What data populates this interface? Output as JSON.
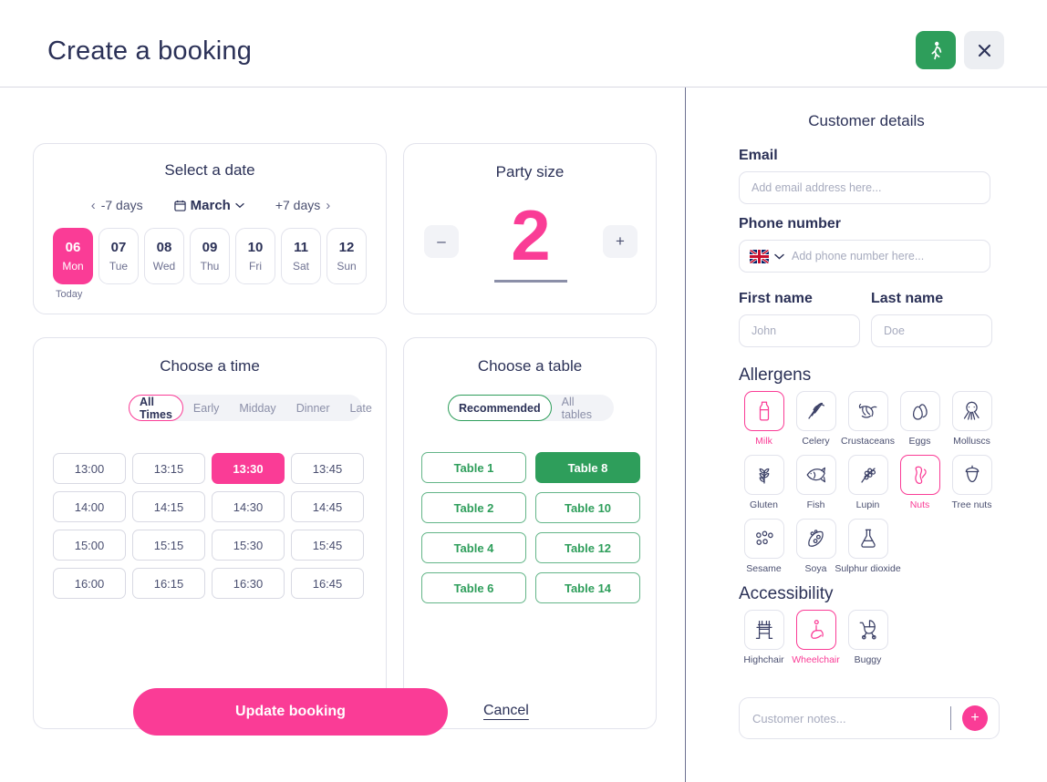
{
  "header": {
    "title": "Create a booking",
    "walkin_icon": "walking-person-icon",
    "walkin_color": "#2E9E5B",
    "close_icon": "close-icon"
  },
  "accent": {
    "pink": "#FA3C96",
    "green": "#2E9E5B",
    "navy": "#2B3157"
  },
  "date_section": {
    "title": "Select a date",
    "prev_label": "-7 days",
    "next_label": "+7 days",
    "month": "March",
    "calendar_icon": "calendar-icon",
    "chevron_left_icon": "chevron-left-icon",
    "chevron_right_icon": "chevron-right-icon",
    "chevron_down_icon": "chevron-down-icon",
    "today_label": "Today",
    "days": [
      {
        "num": "06",
        "dow": "Mon",
        "selected": true
      },
      {
        "num": "07",
        "dow": "Tue",
        "selected": false
      },
      {
        "num": "08",
        "dow": "Wed",
        "selected": false
      },
      {
        "num": "09",
        "dow": "Thu",
        "selected": false
      },
      {
        "num": "10",
        "dow": "Fri",
        "selected": false
      },
      {
        "num": "11",
        "dow": "Sat",
        "selected": false
      },
      {
        "num": "12",
        "dow": "Sun",
        "selected": false
      }
    ]
  },
  "party_section": {
    "title": "Party size",
    "value": "2",
    "decrement_label": "–",
    "increment_label": "+"
  },
  "time_section": {
    "title": "Choose a time",
    "filters": [
      {
        "label": "All Times",
        "active": true
      },
      {
        "label": "Early",
        "active": false
      },
      {
        "label": "Midday",
        "active": false
      },
      {
        "label": "Dinner",
        "active": false
      },
      {
        "label": "Late",
        "active": false
      }
    ],
    "slots": [
      {
        "label": "13:00",
        "selected": false
      },
      {
        "label": "13:15",
        "selected": false
      },
      {
        "label": "13:30",
        "selected": true
      },
      {
        "label": "13:45",
        "selected": false
      },
      {
        "label": "14:00",
        "selected": false
      },
      {
        "label": "14:15",
        "selected": false
      },
      {
        "label": "14:30",
        "selected": false
      },
      {
        "label": "14:45",
        "selected": false
      },
      {
        "label": "15:00",
        "selected": false
      },
      {
        "label": "15:15",
        "selected": false
      },
      {
        "label": "15:30",
        "selected": false
      },
      {
        "label": "15:45",
        "selected": false
      },
      {
        "label": "16:00",
        "selected": false
      },
      {
        "label": "16:15",
        "selected": false
      },
      {
        "label": "16:30",
        "selected": false
      },
      {
        "label": "16:45",
        "selected": false
      }
    ]
  },
  "table_section": {
    "title": "Choose a table",
    "filters": [
      {
        "label": "Recommended",
        "active": true
      },
      {
        "label": "All tables",
        "active": false
      }
    ],
    "tables": [
      {
        "label": "Table 1",
        "selected": false
      },
      {
        "label": "Table 8",
        "selected": true
      },
      {
        "label": "Table 2",
        "selected": false
      },
      {
        "label": "Table 10",
        "selected": false
      },
      {
        "label": "Table 4",
        "selected": false
      },
      {
        "label": "Table 12",
        "selected": false
      },
      {
        "label": "Table 6",
        "selected": false
      },
      {
        "label": "Table 14",
        "selected": false
      }
    ]
  },
  "actions": {
    "submit_label": "Update booking",
    "cancel_label": "Cancel"
  },
  "customer": {
    "title": "Customer details",
    "email_label": "Email",
    "email_value": "",
    "email_placeholder": "Add email address here...",
    "phone_label": "Phone number",
    "phone_value": "",
    "phone_placeholder": "Add phone number here...",
    "phone_country_flag": "uk-flag-icon",
    "first_name_label": "First name",
    "first_name_value": "",
    "first_name_placeholder": "John",
    "last_name_label": "Last name",
    "last_name_value": "",
    "last_name_placeholder": "Doe",
    "notes_value": "",
    "notes_placeholder": "Customer notes...",
    "notes_add_label": "+"
  },
  "allergens": {
    "title": "Allergens",
    "items": [
      {
        "label": "Milk",
        "icon": "milk-bottle-icon",
        "selected": true
      },
      {
        "label": "Celery",
        "icon": "celery-icon",
        "selected": false
      },
      {
        "label": "Crustaceans",
        "icon": "shrimp-icon",
        "selected": false
      },
      {
        "label": "Eggs",
        "icon": "eggs-icon",
        "selected": false
      },
      {
        "label": "Molluscs",
        "icon": "squid-icon",
        "selected": false
      },
      {
        "label": "Gluten",
        "icon": "wheat-icon",
        "selected": false
      },
      {
        "label": "Fish",
        "icon": "fish-icon",
        "selected": false
      },
      {
        "label": "Lupin",
        "icon": "lupin-icon",
        "selected": false
      },
      {
        "label": "Nuts",
        "icon": "peanut-icon",
        "selected": true
      },
      {
        "label": "Tree nuts",
        "icon": "acorn-icon",
        "selected": false
      },
      {
        "label": "Sesame",
        "icon": "sesame-seeds-icon",
        "selected": false
      },
      {
        "label": "Soya",
        "icon": "soya-pod-icon",
        "selected": false
      },
      {
        "label": "Sulphur dioxide",
        "icon": "flask-icon",
        "selected": false
      }
    ]
  },
  "accessibility": {
    "title": "Accessibility",
    "items": [
      {
        "label": "Highchair",
        "icon": "highchair-icon",
        "selected": false
      },
      {
        "label": "Wheelchair",
        "icon": "wheelchair-icon",
        "selected": true
      },
      {
        "label": "Buggy",
        "icon": "buggy-icon",
        "selected": false
      }
    ]
  }
}
